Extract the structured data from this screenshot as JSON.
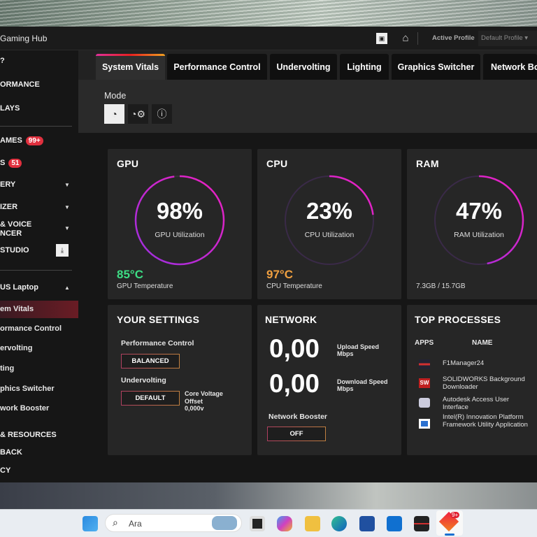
{
  "app": {
    "title": "Gaming Hub",
    "active_profile_label": "Active Profile",
    "profile_value": "Default Profile"
  },
  "sidebar": {
    "items": [
      {
        "label": "?"
      },
      {
        "label": "ORMANCE"
      },
      {
        "label": "LAYS"
      },
      {
        "label": "AMES",
        "badge": "99+"
      },
      {
        "label": "S",
        "badge": "51"
      },
      {
        "label": "ERY"
      },
      {
        "label": "IZER"
      },
      {
        "label": "& VOICE",
        "label2": "NCER"
      },
      {
        "label": "STUDIO"
      },
      {
        "label": "US Laptop"
      },
      {
        "label": "em Vitals"
      },
      {
        "label": "ormance Control"
      },
      {
        "label": "ervolting"
      },
      {
        "label": "ting"
      },
      {
        "label": "phics Switcher"
      },
      {
        "label": "work Booster"
      },
      {
        "label": "& RESOURCES"
      },
      {
        "label": "BACK"
      },
      {
        "label": "CY"
      }
    ]
  },
  "tabs": [
    "System Vitals",
    "Performance Control",
    "Undervolting",
    "Lighting",
    "Graphics Switcher",
    "Network Bo"
  ],
  "mode": {
    "label": "Mode",
    "buttons": [
      "gauge-icon",
      "gauge-settings-icon",
      "info-icon"
    ]
  },
  "vitals": {
    "gpu": {
      "title": "GPU",
      "value": "98%",
      "percent": 98,
      "label": "GPU Utilization",
      "temp": "85°C",
      "temp_label": "GPU Temperature",
      "temp_color": "#3ddc84"
    },
    "cpu": {
      "title": "CPU",
      "value": "23%",
      "percent": 23,
      "label": "CPU Utilization",
      "temp": "97°C",
      "temp_label": "CPU Temperature",
      "temp_color": "#f0a040"
    },
    "ram": {
      "title": "RAM",
      "value": "47%",
      "percent": 47,
      "label": "RAM Utilization",
      "usage": "7.3GB / 15.7GB"
    }
  },
  "settings": {
    "title": "YOUR SETTINGS",
    "perf_label": "Performance Control",
    "perf_value": "BALANCED",
    "uv_label": "Undervolting",
    "uv_value": "DEFAULT",
    "cv_line1": "Core Voltage",
    "cv_line2": "Offset",
    "cv_value": "0,000v"
  },
  "network": {
    "title": "NETWORK",
    "upload": "0,00",
    "upload_label": "Upload Speed",
    "upload_unit": "Mbps",
    "download": "0,00",
    "download_label": "Download Speed",
    "download_unit": "Mbps",
    "booster_label": "Network Booster",
    "booster_value": "OFF"
  },
  "processes": {
    "title": "TOP PROCESSES",
    "col_apps": "APPS",
    "col_name": "NAME",
    "items": [
      {
        "name": "F1Manager24"
      },
      {
        "name": "SOLIDWORKS Background Downloader"
      },
      {
        "name": "Autodesk Access User Interface"
      },
      {
        "name": "Intel(R) Innovation Platform Framework Utility Application"
      }
    ]
  },
  "taskbar": {
    "search_placeholder": "Ara",
    "notification_badge": "9+"
  },
  "colors": {
    "accent_start": "#e0309a",
    "accent_mid": "#e82020",
    "accent_end": "#f0a020",
    "ring_start": "#9a30e0",
    "ring_end": "#f020c0"
  }
}
